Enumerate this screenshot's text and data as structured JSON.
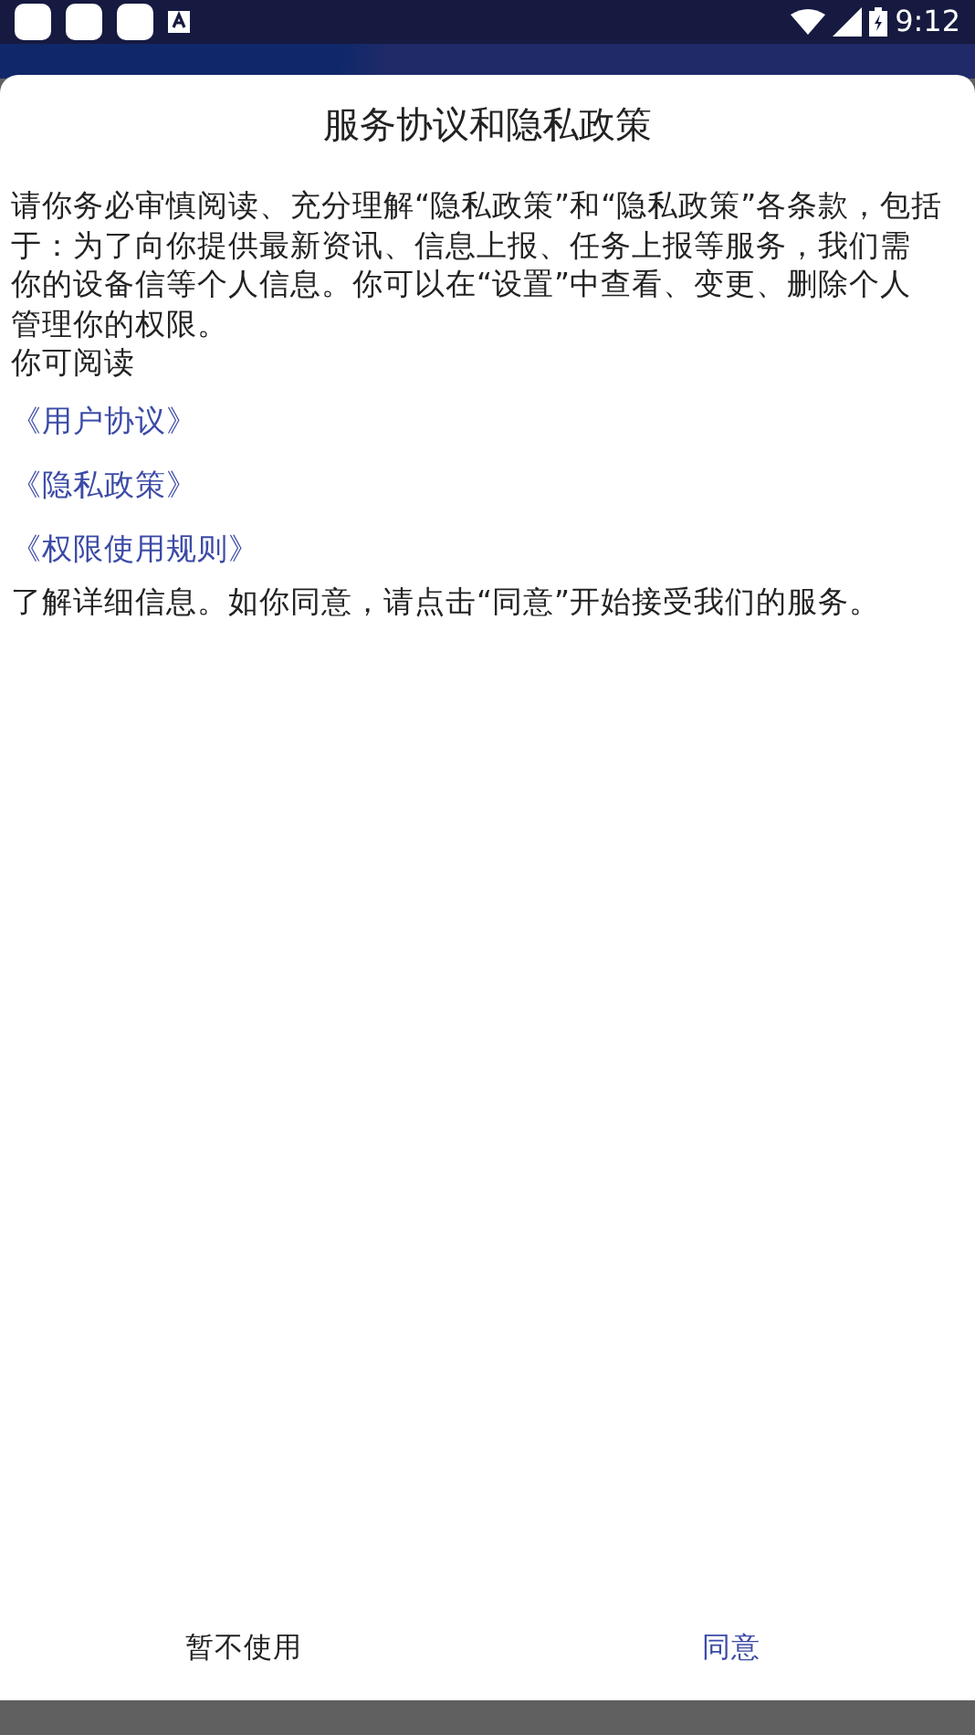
{
  "status_bar": {
    "time": "9:12"
  },
  "dialog": {
    "title": "服务协议和隐私政策",
    "intro_lines": [
      "请你务必审慎阅读、充分理解“隐私政策”和“隐私政策”各条款，包括",
      "于：为了向你提供最新资讯、信息上报、任务上报等服务，我们需",
      "你的设备信等个人信息。你可以在“设置”中查看、变更、删除个人",
      "管理你的权限。",
      "你可阅读"
    ],
    "links": [
      "《用户协议》",
      "《隐私政策》",
      "《权限使用规则》"
    ],
    "outro": "了解详细信息。如你同意，请点击“同意”开始接受我们的服务。",
    "buttons": [
      {
        "label": "暂不使用",
        "kind": "secondary"
      },
      {
        "label": "同意",
        "kind": "primary"
      }
    ]
  }
}
